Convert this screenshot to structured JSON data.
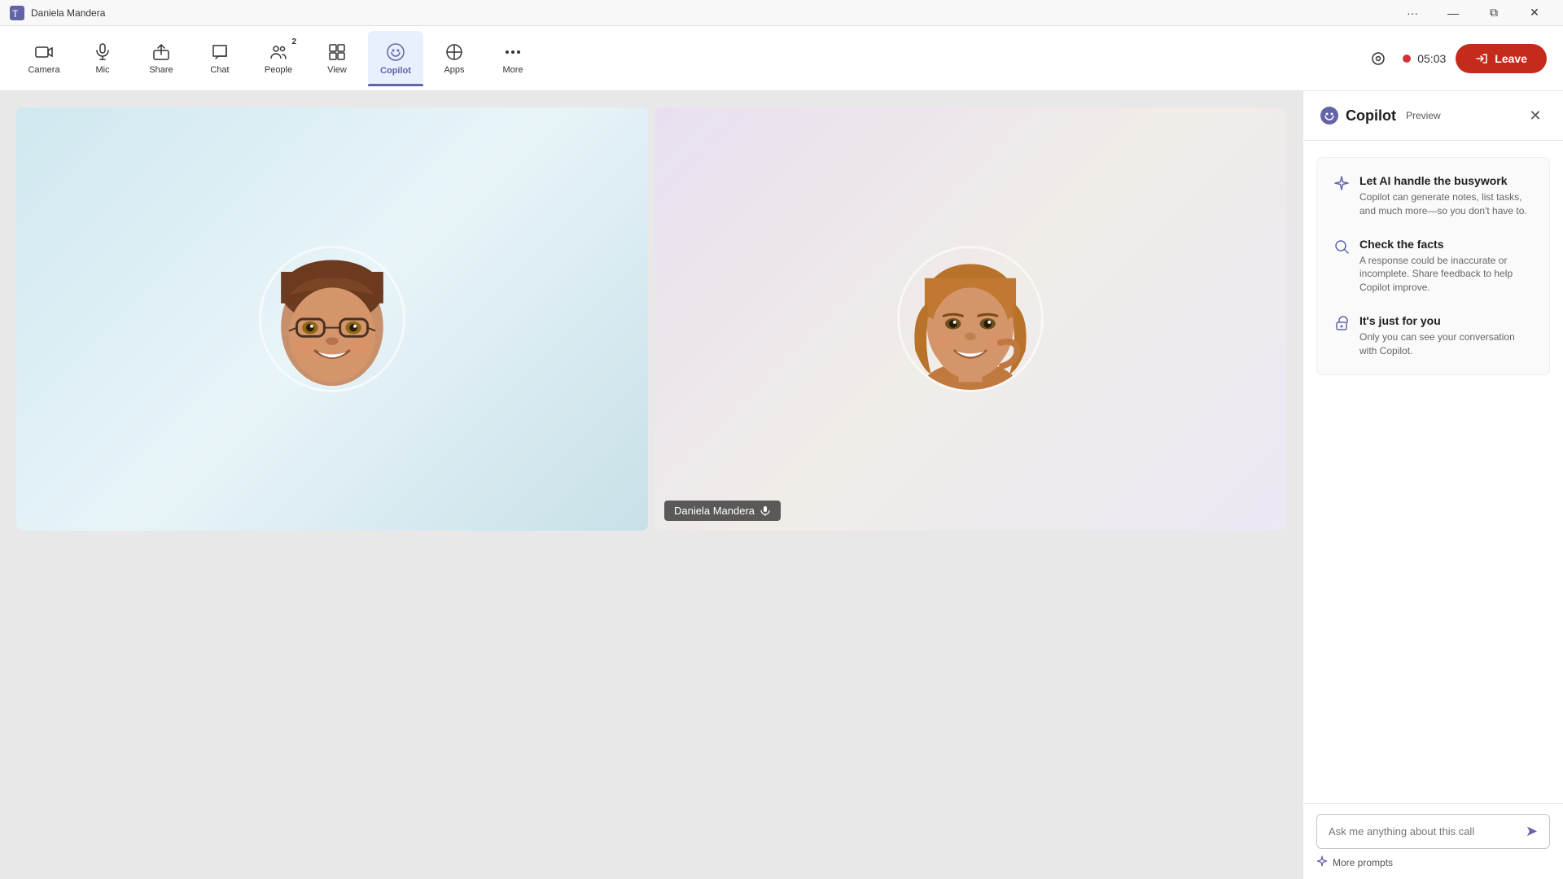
{
  "titleBar": {
    "title": "Daniela Mandera",
    "controls": {
      "more": "···",
      "minimize": "—",
      "restore": "⧉",
      "close": "✕"
    }
  },
  "toolbar": {
    "buttons": [
      {
        "id": "camera",
        "label": "Camera",
        "icon": "📷",
        "badge": null,
        "active": false
      },
      {
        "id": "mic",
        "label": "Mic",
        "icon": "🎤",
        "badge": null,
        "active": false
      },
      {
        "id": "share",
        "label": "Share",
        "icon": "⬆",
        "badge": null,
        "active": false
      },
      {
        "id": "chat",
        "label": "Chat",
        "icon": "💬",
        "badge": null,
        "active": false
      },
      {
        "id": "people",
        "label": "People",
        "icon": "👥",
        "badge": "2",
        "active": false
      },
      {
        "id": "view",
        "label": "View",
        "icon": "⊞",
        "badge": null,
        "active": false
      },
      {
        "id": "copilot",
        "label": "Copilot",
        "icon": "🤖",
        "badge": null,
        "active": true
      },
      {
        "id": "apps",
        "label": "Apps",
        "icon": "➕",
        "badge": null,
        "active": false
      },
      {
        "id": "more",
        "label": "More",
        "icon": "···",
        "badge": null,
        "active": false
      }
    ],
    "timer": "05:03",
    "leaveLabel": "Leave"
  },
  "callArea": {
    "participants": [
      {
        "name": "",
        "hasMic": false
      },
      {
        "name": "Daniela Mandera",
        "hasMic": true
      }
    ]
  },
  "copilotPanel": {
    "title": "Copilot",
    "previewLabel": "Preview",
    "closeLabel": "✕",
    "features": [
      {
        "icon": "sparkle",
        "heading": "Let AI handle the busywork",
        "body": "Copilot can generate notes, list tasks, and much more—so you don't have to."
      },
      {
        "icon": "search",
        "heading": "Check the facts",
        "body": "A response could be inaccurate or incomplete. Share feedback to help Copilot improve."
      },
      {
        "icon": "lock",
        "heading": "It's just for you",
        "body": "Only you can see your conversation with Copilot."
      }
    ],
    "inputPlaceholder": "Ask me anything about this call",
    "morePromptsLabel": "More prompts",
    "sendIcon": "➤"
  }
}
